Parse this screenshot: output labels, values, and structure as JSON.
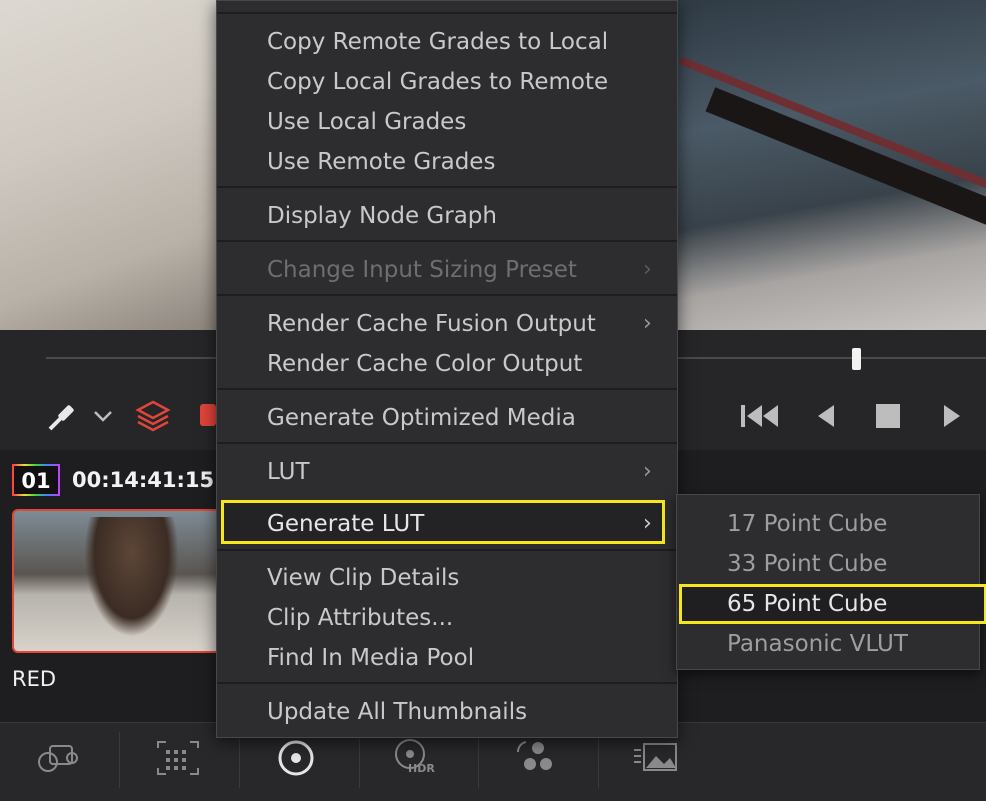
{
  "context_menu": {
    "items": [
      {
        "label": "Copy Remote Grades to Local",
        "enabled": true
      },
      {
        "label": "Copy Local Grades to Remote",
        "enabled": true
      },
      {
        "label": "Use Local Grades",
        "enabled": true
      },
      {
        "label": "Use Remote Grades",
        "enabled": true
      },
      {
        "label": "Display Node Graph",
        "enabled": true
      },
      {
        "label": "Change Input Sizing Preset",
        "enabled": false,
        "submenu": true
      },
      {
        "label": "Render Cache Fusion Output",
        "enabled": true,
        "submenu": true
      },
      {
        "label": "Render Cache Color Output",
        "enabled": true
      },
      {
        "label": "Generate Optimized Media",
        "enabled": true
      },
      {
        "label": "LUT",
        "enabled": true,
        "submenu": true
      },
      {
        "label": "Generate LUT",
        "enabled": true,
        "submenu": true,
        "highlighted": true
      },
      {
        "label": "View Clip Details",
        "enabled": true
      },
      {
        "label": "Clip Attributes...",
        "enabled": true
      },
      {
        "label": "Find In Media Pool",
        "enabled": true
      },
      {
        "label": "Update All Thumbnails",
        "enabled": true
      }
    ],
    "arrow_glyph": "›"
  },
  "submenu": {
    "items": [
      {
        "label": "17 Point Cube"
      },
      {
        "label": "33 Point Cube"
      },
      {
        "label": "65 Point Cube",
        "highlighted": true
      },
      {
        "label": "Panasonic VLUT"
      }
    ]
  },
  "clip": {
    "number": "01",
    "timecode": "00:14:41:15",
    "name": "RED"
  },
  "colors": {
    "highlight_border": "#f5e61d",
    "accent_red": "#e2453a",
    "menu_bg": "#2d2d30"
  },
  "icons": {
    "transport": [
      "eyedropper-icon",
      "chevron-down-icon",
      "layers-icon",
      "skip-to-start-icon",
      "reverse-play-icon",
      "stop-icon",
      "play-icon"
    ],
    "toolbar": [
      "camera-raw-icon",
      "color-match-icon",
      "primaries-icon",
      "hdr-icon",
      "rgb-mixer-icon",
      "motion-effects-icon"
    ]
  },
  "toolbar": {
    "hdr_label": "HDR"
  }
}
